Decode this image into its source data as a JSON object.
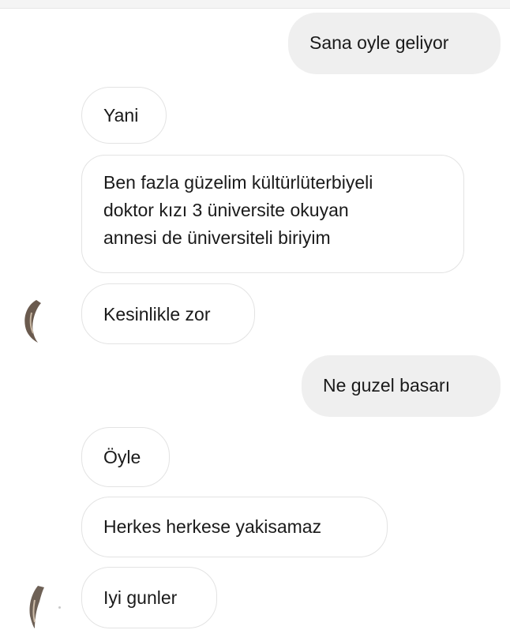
{
  "conversation": {
    "messages": [
      {
        "side": "sent",
        "text": "Sana oyle geliyor"
      },
      {
        "side": "received",
        "text": "Yani"
      },
      {
        "side": "received",
        "lines": [
          "Ben fazla güzelim kültürlüterbiyeli",
          "doktor kızı 3 üniversite okuyan",
          "annesi de üniversiteli biriyim"
        ]
      },
      {
        "side": "received",
        "text": "Kesinlikle zor"
      },
      {
        "side": "sent",
        "text": "Ne guzel basarı"
      },
      {
        "side": "received",
        "text": "Öyle"
      },
      {
        "side": "received",
        "text": "Herkes herkese yakisamaz"
      },
      {
        "side": "received",
        "text": "Iyi gunler"
      }
    ]
  },
  "icons": {
    "contact_avatar": "contact-avatar-icon"
  },
  "colors": {
    "sent_bubble": "#efefef",
    "received_bubble_border": "#e3e3e3",
    "text": "#1a1a1a",
    "background": "#ffffff"
  }
}
